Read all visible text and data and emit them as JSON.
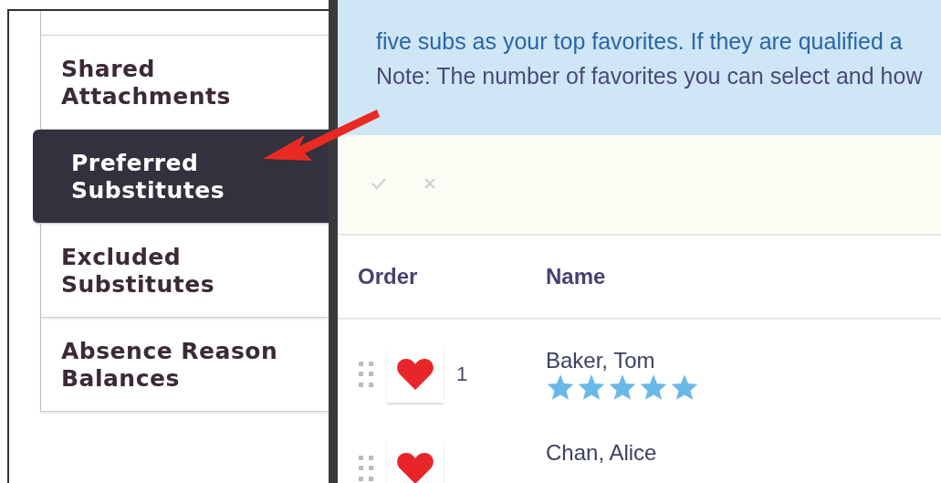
{
  "sidebar": {
    "items": [
      {
        "label": "Shared Attachments",
        "selected": false
      },
      {
        "label": "Preferred Substitutes",
        "selected": true
      },
      {
        "label": "Excluded Substitutes",
        "selected": false
      },
      {
        "label": "Absence Reason Balances",
        "selected": false
      }
    ]
  },
  "info": {
    "lines": [
      "five subs as your top favorites. If they are qualified a",
      "Note: The number of favorites you can select and how"
    ]
  },
  "toolbar": {
    "buttons": [
      {
        "kind": "accept",
        "disabled": true
      },
      {
        "kind": "remove",
        "disabled": true
      }
    ]
  },
  "table": {
    "columns": [
      "Order",
      "Name"
    ],
    "rows": [
      {
        "order": "1",
        "name": "Baker, Tom",
        "stars": 5
      },
      {
        "name": "Chan, Alice"
      }
    ]
  }
}
